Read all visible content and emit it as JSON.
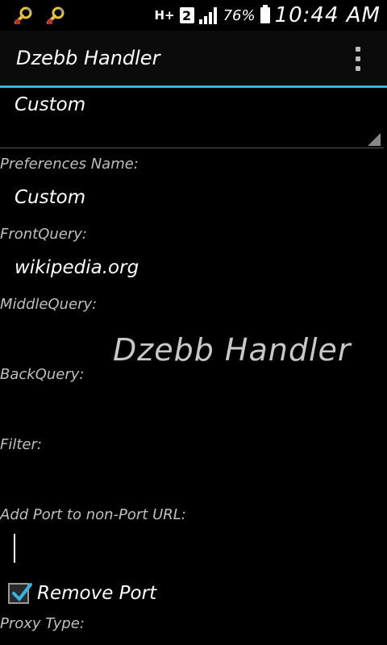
{
  "status_bar": {
    "left_icons": [
      "wrench-notification-icon",
      "wrench-notification-icon"
    ],
    "network": "H+",
    "sim": "2",
    "battery_percent": "76%",
    "time": "10:44 AM"
  },
  "action_bar": {
    "title": "Dzebb Handler"
  },
  "spinner": {
    "selected": "Custom"
  },
  "fields": {
    "preferences_name_label": "Preferences Name:",
    "preferences_name_value": "Custom",
    "front_query_label": "FrontQuery:",
    "front_query_value": "wikipedia.org",
    "middle_query_label": "MiddleQuery:",
    "back_query_label": "BackQuery:",
    "filter_label": "Filter:",
    "add_port_label": "Add Port to non-Port URL:",
    "remove_port_label": "Remove Port",
    "proxy_type_label": "Proxy Type:"
  },
  "watermark": "Dzebb Handler",
  "colors": {
    "accent": "#33b5e5",
    "background": "#000000"
  }
}
